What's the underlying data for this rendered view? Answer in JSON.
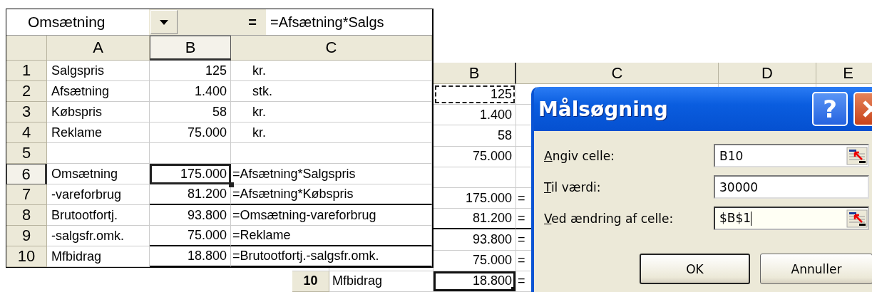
{
  "name_box": {
    "value": "Omsætning"
  },
  "formula_bar": {
    "equals": "=",
    "formula": "=Afsætning*Salgs"
  },
  "sheet": {
    "columns": [
      {
        "label": "A",
        "selected": false
      },
      {
        "label": "B",
        "selected": true
      },
      {
        "label": "C",
        "selected": false
      }
    ],
    "rows": [
      {
        "number": "1",
        "label": "Salgspris",
        "value": "125",
        "c": {
          "text": "kr.",
          "kind": "unit"
        },
        "selected": false,
        "border_below": false
      },
      {
        "number": "2",
        "label": "Afsætning",
        "value": "1.400",
        "c": {
          "text": "stk.",
          "kind": "unit"
        },
        "selected": false,
        "border_below": false
      },
      {
        "number": "3",
        "label": "Købspris",
        "value": "58",
        "c": {
          "text": "kr.",
          "kind": "unit"
        },
        "selected": false,
        "border_below": false
      },
      {
        "number": "4",
        "label": "Reklame",
        "value": "75.000",
        "c": {
          "text": "kr.",
          "kind": "unit"
        },
        "selected": false,
        "border_below": false
      },
      {
        "number": "5",
        "selected": false,
        "border_below": false
      },
      {
        "number": "6",
        "label": "Omsætning",
        "value": "175.000",
        "c": {
          "text": "=Afsætning*Salgspris",
          "kind": "formula"
        },
        "selected": true,
        "border_below": false
      },
      {
        "number": "7",
        "label": "-vareforbrug",
        "value": "81.200",
        "c": {
          "text": "=Afsætning*Købspris",
          "kind": "formula"
        },
        "selected": false,
        "border_below": true
      },
      {
        "number": "8",
        "label": "Brutootfortj.",
        "value": "93.800",
        "c": {
          "text": "=Omsætning-vareforbrug",
          "kind": "formula"
        },
        "selected": false,
        "border_below": false
      },
      {
        "number": "9",
        "label": "-salgsfr.omk.",
        "value": "75.000",
        "c": {
          "text": "=Reklame",
          "kind": "formula"
        },
        "selected": false,
        "border_below": true
      },
      {
        "number": "10",
        "label": "Mfbidrag",
        "value": "18.800",
        "c": {
          "text": "=Brutootfortj.-salgsfr.omk.",
          "kind": "formula"
        },
        "selected": false,
        "border_below": true
      }
    ]
  },
  "right_sheet": {
    "columns": [
      {
        "label": "B",
        "selected": true
      },
      {
        "label": "C",
        "selected": false
      },
      {
        "label": "D",
        "selected": false
      },
      {
        "label": "E",
        "selected": false
      }
    ],
    "rows": [
      {
        "value": "125",
        "copied": true,
        "selected": false,
        "border_below": false
      },
      {
        "value": "1.400",
        "copied": false,
        "selected": false,
        "border_below": false
      },
      {
        "value": "58",
        "copied": false,
        "selected": false,
        "border_below": false
      },
      {
        "value": "75.000",
        "copied": false,
        "selected": false,
        "border_below": false
      },
      {
        "copied": false,
        "selected": false,
        "border_below": false
      },
      {
        "value": "175.000",
        "c": "=",
        "copied": false,
        "selected": false,
        "border_below": false
      },
      {
        "value": "81.200",
        "c": "=",
        "copied": false,
        "selected": false,
        "border_below": true
      },
      {
        "value": "93.800",
        "c": "=",
        "copied": false,
        "selected": false,
        "border_below": false
      },
      {
        "value": "75.000",
        "c": "=",
        "copied": false,
        "selected": false,
        "border_below": false
      },
      {
        "number": "10",
        "label": "Mfbidrag",
        "value": "18.800",
        "c": "=",
        "copied": false,
        "selected": true,
        "border_below": false
      }
    ]
  },
  "dialog": {
    "title": "Målsøgning",
    "help": "?",
    "fields": [
      {
        "label": "Angiv celle:",
        "value": "B10",
        "picker": true,
        "focused": false
      },
      {
        "label": "Til værdi:",
        "value": "30000",
        "picker": false,
        "focused": false
      },
      {
        "label": "Ved ændring af celle:",
        "value": "$B$1",
        "picker": true,
        "focused": true
      }
    ],
    "buttons": [
      {
        "label": "OK",
        "default": true
      },
      {
        "label": "Annuller",
        "default": false
      }
    ]
  }
}
